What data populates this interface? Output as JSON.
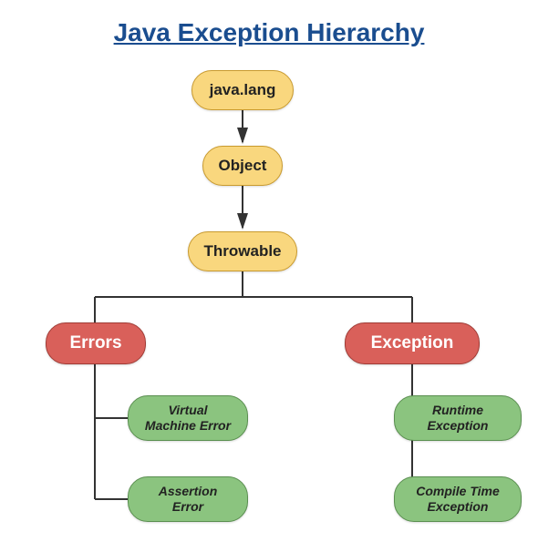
{
  "title": "Java Exception Hierarchy ",
  "nodes": {
    "javalang": {
      "label": "java.lang"
    },
    "object": {
      "label": "Object"
    },
    "throwable": {
      "label": "Throwable"
    },
    "errors": {
      "label": "Errors"
    },
    "exception": {
      "label": "Exception"
    },
    "vme": {
      "label": "Virtual Machine Error"
    },
    "assertion": {
      "label": "Assertion Error"
    },
    "runtime": {
      "label": "Runtime Exception"
    },
    "compiletime": {
      "label": "Compile Time Exception"
    }
  }
}
